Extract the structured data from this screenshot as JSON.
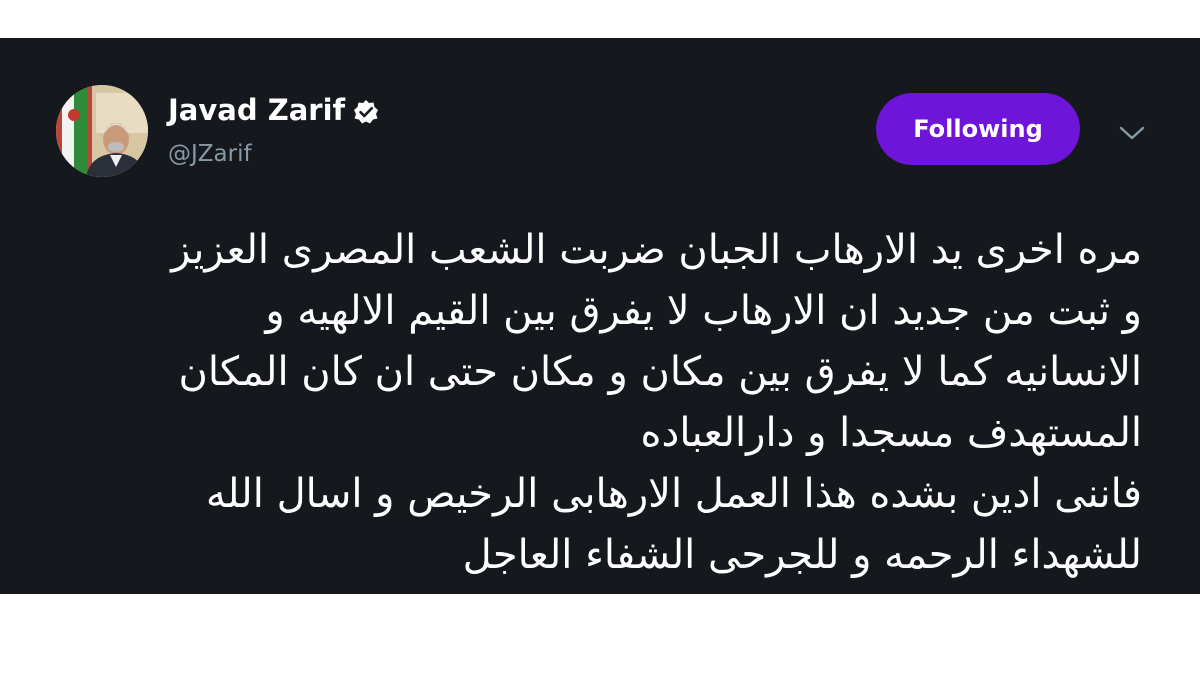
{
  "tweet": {
    "author": {
      "display_name": "Javad Zarif",
      "handle": "@JZarif",
      "verified": true,
      "avatar": "profile-photo"
    },
    "follow_button_label": "Following",
    "menu_icon": "chevron-down-icon",
    "text_lines": [
      "مره اخرى يد الارهاب الجبان ضربت الشعب المصرى العزيز",
      "و ثبت من جديد ان الارهاب لا يفرق بين القيم الالهيه و",
      "الانسانيه كما لا يفرق بين مكان و مكان حتى ان كان المكان",
      "المستهدف مسجدا و دارالعباده",
      "فاننى ادين بشده هذا العمل الارهابى الرخيص و اسال الله",
      "للشهداء الرحمه و للجرحى الشفاء العاجل"
    ]
  },
  "colors": {
    "card_background": "#15181c",
    "page_background": "#ffffff",
    "text_primary": "#ffffff",
    "text_secondary": "#8899a6",
    "button_accent": "#6f14d9",
    "verified_badge": "#ffffff"
  }
}
